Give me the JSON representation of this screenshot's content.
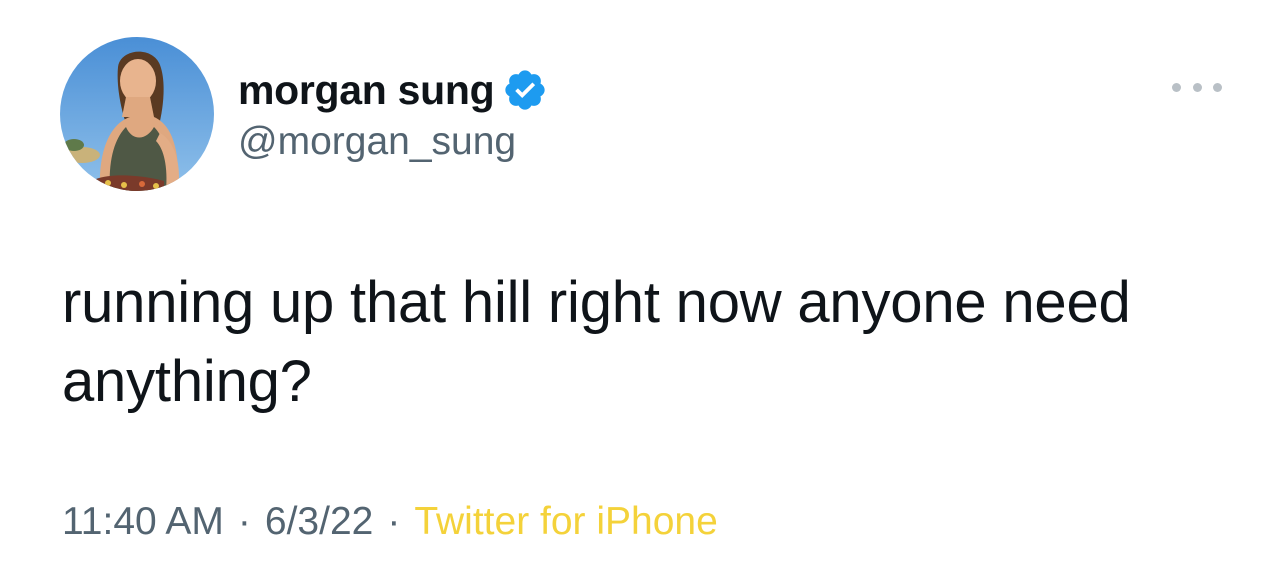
{
  "user": {
    "display_name": "morgan sung",
    "handle": "@morgan_sung",
    "verified": true,
    "verified_color": "#1d9bf0"
  },
  "tweet": {
    "text": "running up that hill right now anyone need anything?"
  },
  "meta": {
    "time": "11:40 AM",
    "separator": "·",
    "date": "6/3/22",
    "source": "Twitter for iPhone",
    "source_color": "#f4d23a"
  },
  "icons": {
    "verified": "verified-badge-icon",
    "more": "more-options-icon"
  }
}
